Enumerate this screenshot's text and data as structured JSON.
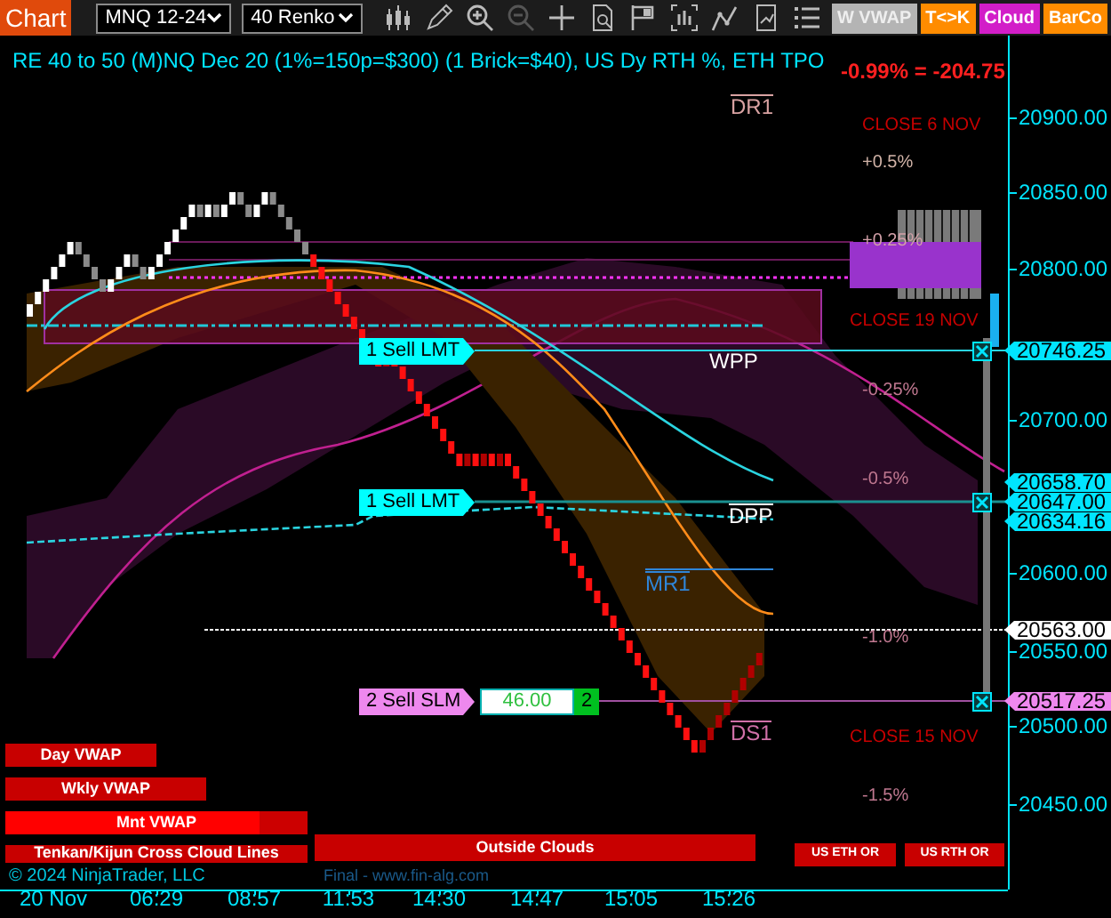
{
  "toolbar": {
    "app_button": "Chart",
    "instrument_selector": "MNQ 12-24",
    "bar_type_selector": "40 Renko",
    "indicator_buttons": [
      {
        "label": "W VWAP",
        "color": "#b4b4b4"
      },
      {
        "label": "T<>K",
        "color": "#ff8c00"
      },
      {
        "label": "Cloud",
        "color": "#d21ec8"
      },
      {
        "label": "BarCo",
        "color": "#ff8c00"
      }
    ]
  },
  "chart": {
    "title": "RE 40 to 50 (M)NQ Dec 20 (1%=150p=$300) (1 Brick=$40), US Dy RTH %, ETH TPO",
    "change": "-0.99% = -204.75",
    "level_labels": [
      {
        "text": "DR1",
        "color": "#d9a2a2",
        "overline": true
      },
      {
        "text": "CLOSE 6 NOV",
        "color": "#c80000",
        "overline": false
      },
      {
        "text": "+0.5%",
        "color": "#d2b4a8",
        "overline": false
      },
      {
        "text": "+0.25%",
        "color": "#d2a0a8",
        "overline": false
      },
      {
        "text": "CLOSE 19 NOV",
        "color": "#c80000",
        "overline": false
      },
      {
        "text": "WPP",
        "color": "#ffffff",
        "overline": false
      },
      {
        "text": "-0.25%",
        "color": "#c07890",
        "overline": false
      },
      {
        "text": "-0.5%",
        "color": "#c07890",
        "overline": false
      },
      {
        "text": "DPP",
        "color": "#ffffff",
        "overline": true
      },
      {
        "text": "MR1",
        "color": "#2f86d8",
        "overline": true
      },
      {
        "text": "-1.0%",
        "color": "#c07890",
        "overline": false
      },
      {
        "text": "DS1",
        "color": "#d070a8",
        "overline": true
      },
      {
        "text": "CLOSE 15 NOV",
        "color": "#c80000",
        "overline": false
      },
      {
        "text": "-1.5%",
        "color": "#c07890",
        "overline": false
      }
    ],
    "orders": [
      {
        "label": "1 Sell LMT",
        "color": "#00ffff"
      },
      {
        "label": "1 Sell LMT",
        "color": "#00ffff"
      },
      {
        "label": "2 Sell SLM",
        "color": "#ee88ee",
        "price": "46.00",
        "quantity": "2"
      }
    ],
    "legend_bars": [
      {
        "label": "Day VWAP"
      },
      {
        "label": "Wkly VWAP"
      },
      {
        "label": "Mnt VWAP"
      },
      {
        "label": "Tenkan/Kijun Cross Cloud Lines"
      },
      {
        "label": "Outside Clouds"
      },
      {
        "label": "US ETH OR"
      },
      {
        "label": "US RTH OR"
      }
    ],
    "copyright": "© 2024 NinjaTrader, LLC",
    "credit": "Final - www.fin-alg.com",
    "price_axis": [
      "20900.00",
      "20850.00",
      "20800.00",
      "20700.00",
      "20600.00",
      "20550.00",
      "20500.00",
      "20450.00"
    ],
    "price_markers": [
      {
        "text": "20746.25",
        "color": "#00e5ff"
      },
      {
        "text": "20658.70",
        "color": "#00e5ff"
      },
      {
        "text": "20647.00",
        "color": "#00e5ff"
      },
      {
        "text": "20634.16",
        "color": "#00e5ff"
      },
      {
        "text": "20563.00",
        "color": "#ffffff"
      },
      {
        "text": "20517.25",
        "color": "#ee88ee"
      }
    ],
    "time_axis": [
      "20 Nov",
      "06:29",
      "08:57",
      "11:53",
      "14:30",
      "14:47",
      "15:05",
      "15:26"
    ]
  }
}
